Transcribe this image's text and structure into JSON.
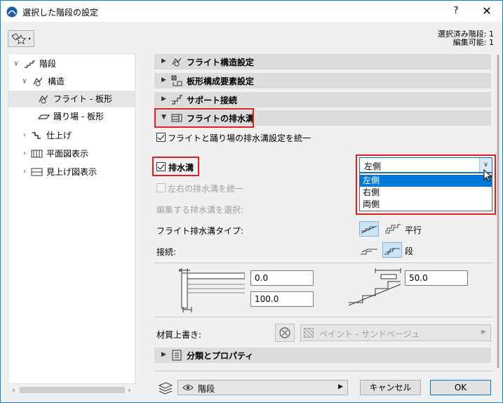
{
  "window": {
    "title": "選択した階段の設定",
    "help": "?",
    "close": "✕"
  },
  "selection_info": {
    "selected": "選択済み階段: 1",
    "editable": "編集可能: 1"
  },
  "tree": {
    "items": [
      {
        "label": "階段",
        "arrow": "∨"
      },
      {
        "label": "構造",
        "arrow": "∨"
      },
      {
        "label": "フライト - 板形",
        "arrow": ""
      },
      {
        "label": "踊り場 - 板形",
        "arrow": ""
      },
      {
        "label": "仕上げ",
        "arrow": "›"
      },
      {
        "label": "平面図表示",
        "arrow": "›"
      },
      {
        "label": "見上げ図表示",
        "arrow": "›"
      }
    ],
    "scroll_left": "‹",
    "scroll_right": "›"
  },
  "sections": {
    "flight_structure": "フライト構造設定",
    "panel_elements": "板形構成要素設定",
    "support": "サポート接続",
    "flight_drain": "フライトの排水溝",
    "classification": "分類とプロパティ"
  },
  "drain": {
    "unify_label": "フライトと踊り場の排水溝設定を統一",
    "drain_label": "排水溝",
    "unify_lr_label": "左右の排水溝を統一",
    "select_label": "編集する排水溝を選択:",
    "type_label": "フライト排水溝タイプ:",
    "type_option": "平行",
    "connection_label": "接続:",
    "connection_option": "段",
    "side_value": "左側",
    "side_options": [
      "左側",
      "右側",
      "両側"
    ],
    "field1": "0.0",
    "field2": "100.0",
    "field3": "50.0"
  },
  "material": {
    "label": "材質上書き:",
    "value": "ペイント - サンドベージュ"
  },
  "footer": {
    "layer": "階段",
    "cancel": "キャンセル",
    "ok": "OK"
  },
  "colors": {
    "highlight": "#e02020",
    "accent": "#0078d7"
  }
}
